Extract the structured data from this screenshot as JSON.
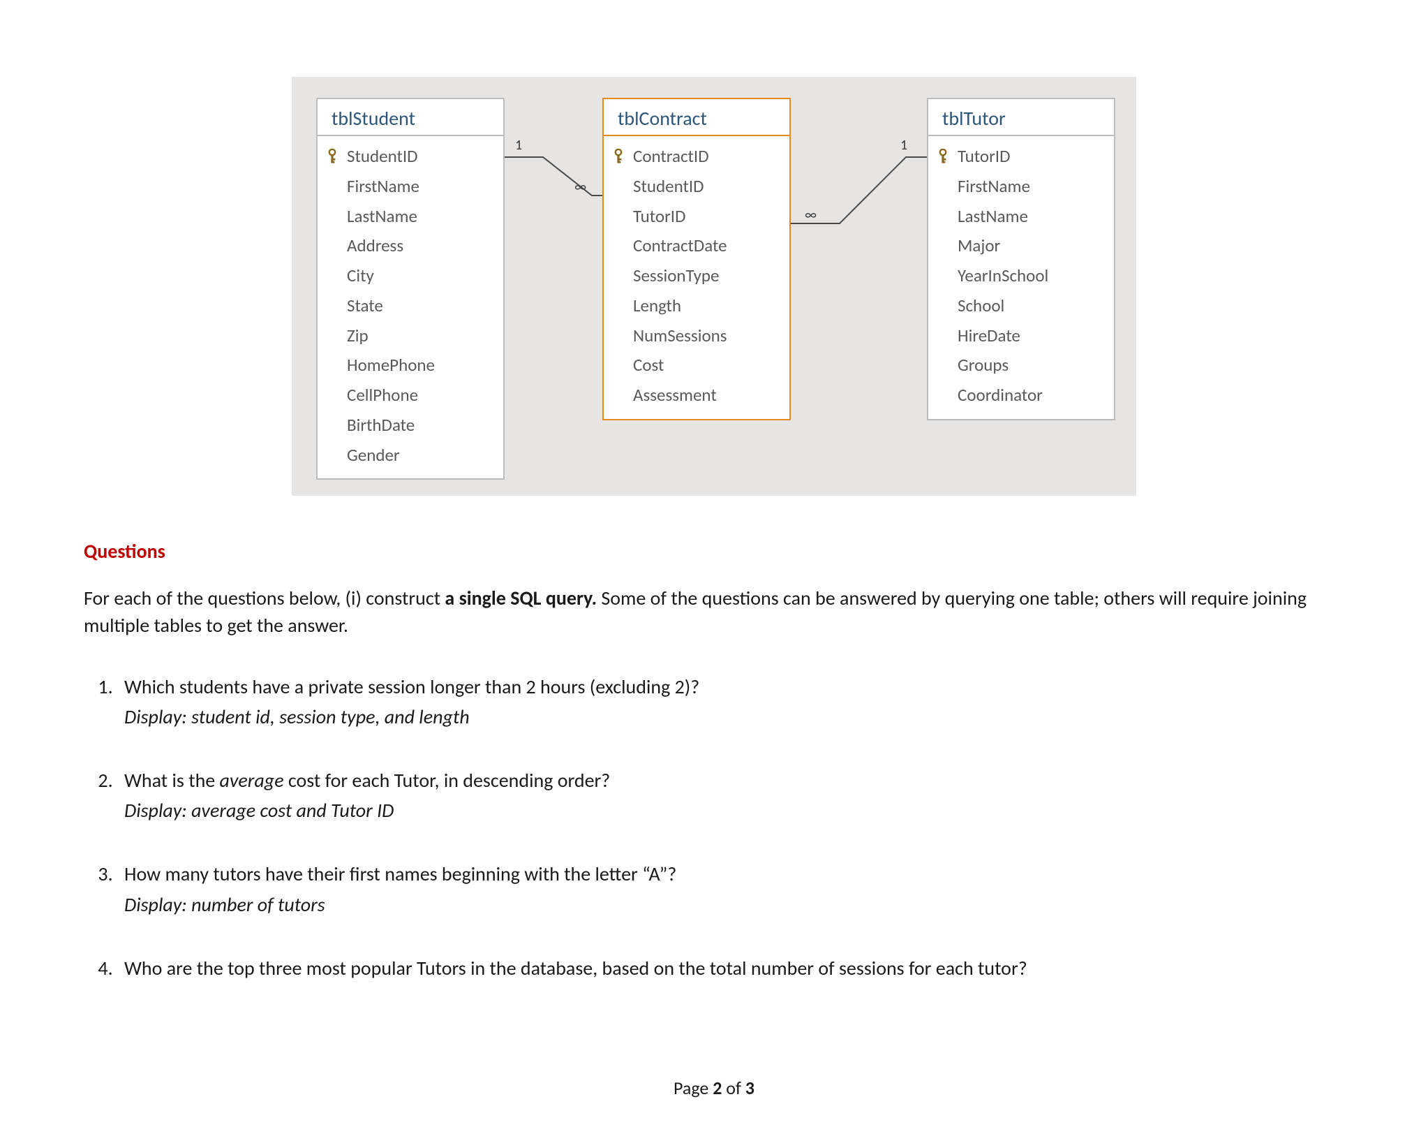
{
  "diagram": {
    "tables": {
      "student": {
        "title": "tblStudent",
        "selected": false,
        "fields": [
          {
            "name": "StudentID",
            "pk": true
          },
          {
            "name": "FirstName",
            "pk": false
          },
          {
            "name": "LastName",
            "pk": false
          },
          {
            "name": "Address",
            "pk": false
          },
          {
            "name": "City",
            "pk": false
          },
          {
            "name": "State",
            "pk": false
          },
          {
            "name": "Zip",
            "pk": false
          },
          {
            "name": "HomePhone",
            "pk": false
          },
          {
            "name": "CellPhone",
            "pk": false
          },
          {
            "name": "BirthDate",
            "pk": false
          },
          {
            "name": "Gender",
            "pk": false
          }
        ]
      },
      "contract": {
        "title": "tblContract",
        "selected": true,
        "fields": [
          {
            "name": "ContractID",
            "pk": true
          },
          {
            "name": "StudentID",
            "pk": false
          },
          {
            "name": "TutorID",
            "pk": false
          },
          {
            "name": "ContractDate",
            "pk": false
          },
          {
            "name": "SessionType",
            "pk": false
          },
          {
            "name": "Length",
            "pk": false
          },
          {
            "name": "NumSessions",
            "pk": false
          },
          {
            "name": "Cost",
            "pk": false
          },
          {
            "name": "Assessment",
            "pk": false
          }
        ]
      },
      "tutor": {
        "title": "tblTutor",
        "selected": false,
        "fields": [
          {
            "name": "TutorID",
            "pk": true
          },
          {
            "name": "FirstName",
            "pk": false
          },
          {
            "name": "LastName",
            "pk": false
          },
          {
            "name": "Major",
            "pk": false
          },
          {
            "name": "YearInSchool",
            "pk": false
          },
          {
            "name": "School",
            "pk": false
          },
          {
            "name": "HireDate",
            "pk": false
          },
          {
            "name": "Groups",
            "pk": false
          },
          {
            "name": "Coordinator",
            "pk": false
          }
        ]
      }
    },
    "relationships": {
      "student_one": "1",
      "contract_many_left": "∞",
      "contract_many_right": "∞",
      "tutor_one": "1"
    }
  },
  "questions_heading": "Questions",
  "intro_pre": "For each of the questions below, (i) construct ",
  "intro_bold": "a single SQL query.",
  "intro_post": " Some of the questions can be answered by querying one table; others will require joining multiple tables to get the answer.",
  "questions": [
    {
      "text": "Which students have a private session longer than 2 hours (excluding 2)?",
      "display": "Display: student id, session type, and length"
    },
    {
      "text_pre": "What is the ",
      "text_em": "average",
      "text_post": " cost for each Tutor, in descending order?",
      "display": "Display: average cost and Tutor ID"
    },
    {
      "text": "How many tutors have their first names beginning with the letter “A”?",
      "display": "Display: number of tutors"
    },
    {
      "text": "Who are the top three most popular Tutors in the database, based on the total number of sessions for each tutor?"
    }
  ],
  "footer": {
    "pre": "Page ",
    "num": "2",
    "mid": " of ",
    "total": "3"
  }
}
